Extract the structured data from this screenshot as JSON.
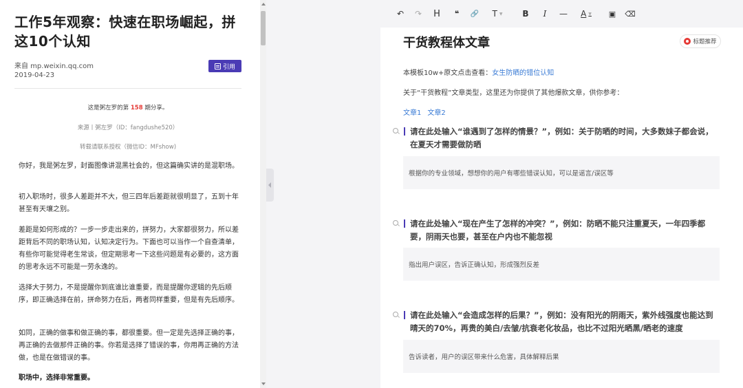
{
  "article": {
    "title": "工作5年观察：快速在职场崛起，拼这10个认知",
    "source": "来自 mp.weixin.qq.com",
    "date": "2019-04-23",
    "cite_label": "引用",
    "share_prefix": "这是粥左罗的第 ",
    "share_number": "158",
    "share_suffix": " 期分享。",
    "source_line": "来源丨粥左罗（ID：fangdushe520）",
    "reprint_line": "转载请联系授权（微信ID：MFshow)",
    "paragraphs": [
      "你好，我是粥左罗，封面图像讲混黑社会的，但这篇确实讲的是混职场。",
      "初入职场时，很多人差距并不大，但三四年后差距就很明显了，五到十年甚至有天壤之别。",
      "差距是如何形成的？一步一步走出来的，拼努力，大家都很努力，所以差距背后不同的职场认知，认知决定行为。下面也可以当作一个自查清单，有些你可能觉得老生常谈，但定期思考一下这些问题是有必要的，这方面的思考永远不可能是一劳永逸的。",
      "选择大于努力，不是提醒你到底谁比谁重要，而是提醒你逻辑的先后顺序，即正确选择在前，拼命努力在后，两者同样重要，但是有先后顺序。",
      "如同，正确的做事和做正确的事，都很重要。但一定是先选择正确的事，再正确的去做那件正确的事。你若是选择了错误的事，你用再正确的方法做，也是在做错误的事。",
      "职场中，选择非常重要。"
    ]
  },
  "toolbar": {
    "undo": "↶",
    "redo": "↷",
    "heading": "H",
    "quote": "❝",
    "link": "🔗",
    "text_type": "T",
    "bold": "B",
    "italic": "I",
    "hr": "—",
    "font_color": "A",
    "image": "▣",
    "clear": "⌫"
  },
  "editor": {
    "title": "干货教程体文章",
    "recommend_label": "标题推荐",
    "line1_prefix": "本模板10w+原文点击查看：",
    "line1_link": "女生防晒的错位认知",
    "line2": "关于“干货教程”文章类型，这里还为你提供了其他爆款文章，供你参考：",
    "links": [
      "文章1",
      "文章2"
    ],
    "sections": [
      {
        "question": "请在此处输入“谁遇到了怎样的情景？”，例如：关于防晒的时间，大多数妹子都会说，在夏天才需要做防晒",
        "hint": "根据你的专业领域，想想你的用户有哪些错误认知，可以是谣言/误区等"
      },
      {
        "question": "请在此处输入“现在产生了怎样的冲突？”，例如：防晒不能只注重夏天，一年四季都要，阴雨天也要，甚至在户内也不能忽视",
        "hint": "指出用户误区，告诉正确认知，形成强烈反差"
      },
      {
        "question": "请在此处输入“会造成怎样的后果？”，例如：没有阳光的阴雨天，紫外线强度也能达到晴天的70%，再贵的美白/去皱/抗衰老化妆品，也比不过阳光晒黑/晒老的速度",
        "hint": "告诉读者，用户的误区带来什么危害，具体解释后果"
      }
    ]
  },
  "colors": {
    "accent": "#4a3bb5",
    "link": "#3a7bd5",
    "highlight": "#e53935"
  }
}
